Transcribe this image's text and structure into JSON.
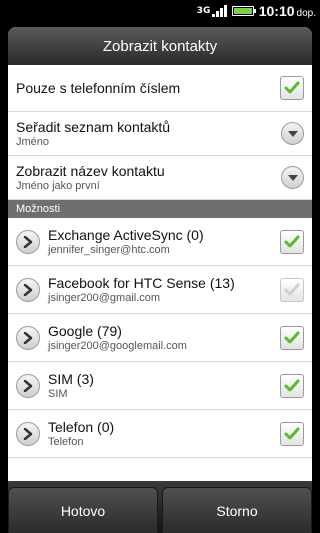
{
  "status": {
    "network": "3G",
    "time": "10:10",
    "ampm": "dop."
  },
  "dialog": {
    "title": "Zobrazit kontakty",
    "options": [
      {
        "label": "Pouze s telefonním číslem",
        "control": "checkbox",
        "checked": true
      },
      {
        "label": "Seřadit seznam kontaktů",
        "value": "Jméno",
        "control": "dropdown"
      },
      {
        "label": "Zobrazit název kontaktu",
        "value": "Jméno jako první",
        "control": "dropdown"
      }
    ],
    "section_header": "Možnosti",
    "accounts": [
      {
        "name": "Exchange ActiveSync (0)",
        "detail": "jennifer_singer@htc.com",
        "checked": true,
        "enabled": true
      },
      {
        "name": "Facebook for HTC Sense (13)",
        "detail": "jsinger200@gmail.com",
        "checked": true,
        "enabled": false
      },
      {
        "name": "Google (79)",
        "detail": "jsinger200@googlemail.com",
        "checked": true,
        "enabled": true
      },
      {
        "name": "SIM (3)",
        "detail": "SIM",
        "checked": true,
        "enabled": true
      },
      {
        "name": "Telefon (0)",
        "detail": "Telefon",
        "checked": true,
        "enabled": true
      }
    ]
  },
  "buttons": {
    "done": "Hotovo",
    "cancel": "Storno"
  },
  "colors": {
    "check_green": "#5fb82a",
    "check_disabled": "#cfcfcf"
  }
}
